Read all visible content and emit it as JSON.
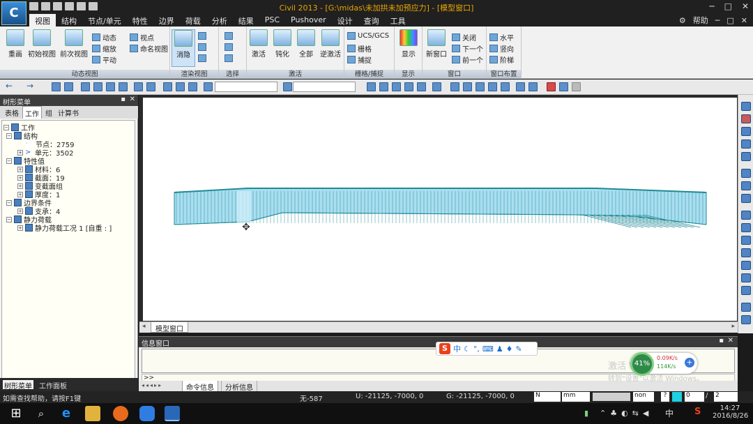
{
  "title": "Civil 2013 - [G:\\midas\\未加拱未加预应力] - [模型窗口]",
  "menu": [
    "视图",
    "结构",
    "节点/单元",
    "特性",
    "边界",
    "荷载",
    "分析",
    "结果",
    "PSC",
    "Pushover",
    "设计",
    "查询",
    "工具"
  ],
  "menu_right": {
    "help": "帮助"
  },
  "window_controls": [
    "─",
    "□",
    "✕"
  ],
  "ribbon": {
    "groups": [
      {
        "label": "动态视图",
        "big": [
          "重画",
          "初始视图",
          "前次视图"
        ],
        "small": [
          "动态",
          "缩放",
          "平动",
          "视点",
          "命名视图"
        ]
      },
      {
        "label": "渲染视图",
        "big": [
          "消隐"
        ],
        "small": []
      },
      {
        "label": "选择",
        "big": [],
        "small": []
      },
      {
        "label": "激活",
        "big": [
          "激活",
          "钝化",
          "全部",
          "逆激活"
        ],
        "small": []
      },
      {
        "label": "栅格/捕捉",
        "big": [],
        "small": [
          "UCS/GCS",
          "栅格",
          "捕捉"
        ]
      },
      {
        "label": "显示",
        "big": [
          "显示"
        ],
        "small": []
      },
      {
        "label": "窗口",
        "big": [
          "新窗口"
        ],
        "small": [
          "关闭",
          "下一个",
          "前一个"
        ]
      },
      {
        "label": "窗口布置",
        "big": [],
        "small": [
          "水平",
          "竖向",
          "阶梯"
        ]
      }
    ]
  },
  "left_panel": {
    "title": "树形菜单",
    "tabs": [
      "表格",
      "工作",
      "组",
      "计算书"
    ],
    "active_tab": "工作",
    "tree": [
      {
        "label": "工作",
        "level": 0
      },
      {
        "label": "结构",
        "level": 1
      },
      {
        "label": "节点：2759",
        "level": 2
      },
      {
        "label": "单元：3502",
        "level": 2
      },
      {
        "label": "特性值",
        "level": 1
      },
      {
        "label": "材料：6",
        "level": 2
      },
      {
        "label": "截面：19",
        "level": 2
      },
      {
        "label": "变截面组",
        "level": 2
      },
      {
        "label": "厚度：1",
        "level": 2
      },
      {
        "label": "边界条件",
        "level": 1
      },
      {
        "label": "支承：4",
        "level": 2
      },
      {
        "label": "静力荷载",
        "level": 1
      },
      {
        "label": "静力荷载工况 1 [自重 : ]",
        "level": 2
      }
    ],
    "bottom_tabs": [
      "树形菜单",
      "工作面板"
    ]
  },
  "model_tab": "模型窗口",
  "info_window": {
    "title": "信息窗口",
    "prompt": ">>",
    "tabs": [
      "命令信息",
      "分析信息"
    ]
  },
  "ime_label": "中",
  "network": {
    "percent": "41%",
    "up": "0.09K/s",
    "down": "114K/s"
  },
  "watermark": "激活 Windows",
  "watermark_sub": "转到\"设置\"以激活 Windows。",
  "status": {
    "help": "如需查找帮助，请按F1键",
    "node": "无-587",
    "ucs": "U: -21125, -7000, 0",
    "gcs": "G: -21125, -7000, 0",
    "unit_force": "N",
    "unit_length": "mm",
    "filter": "non",
    "page_a": "0",
    "page_b": "2"
  },
  "clock": {
    "time": "14:27",
    "date": "2016/8/26"
  },
  "tray_ime": "中",
  "colors": {
    "bridge_fill": "#a9def0",
    "bridge_line": "#1f8a96",
    "accent": "#1a6fd0"
  }
}
